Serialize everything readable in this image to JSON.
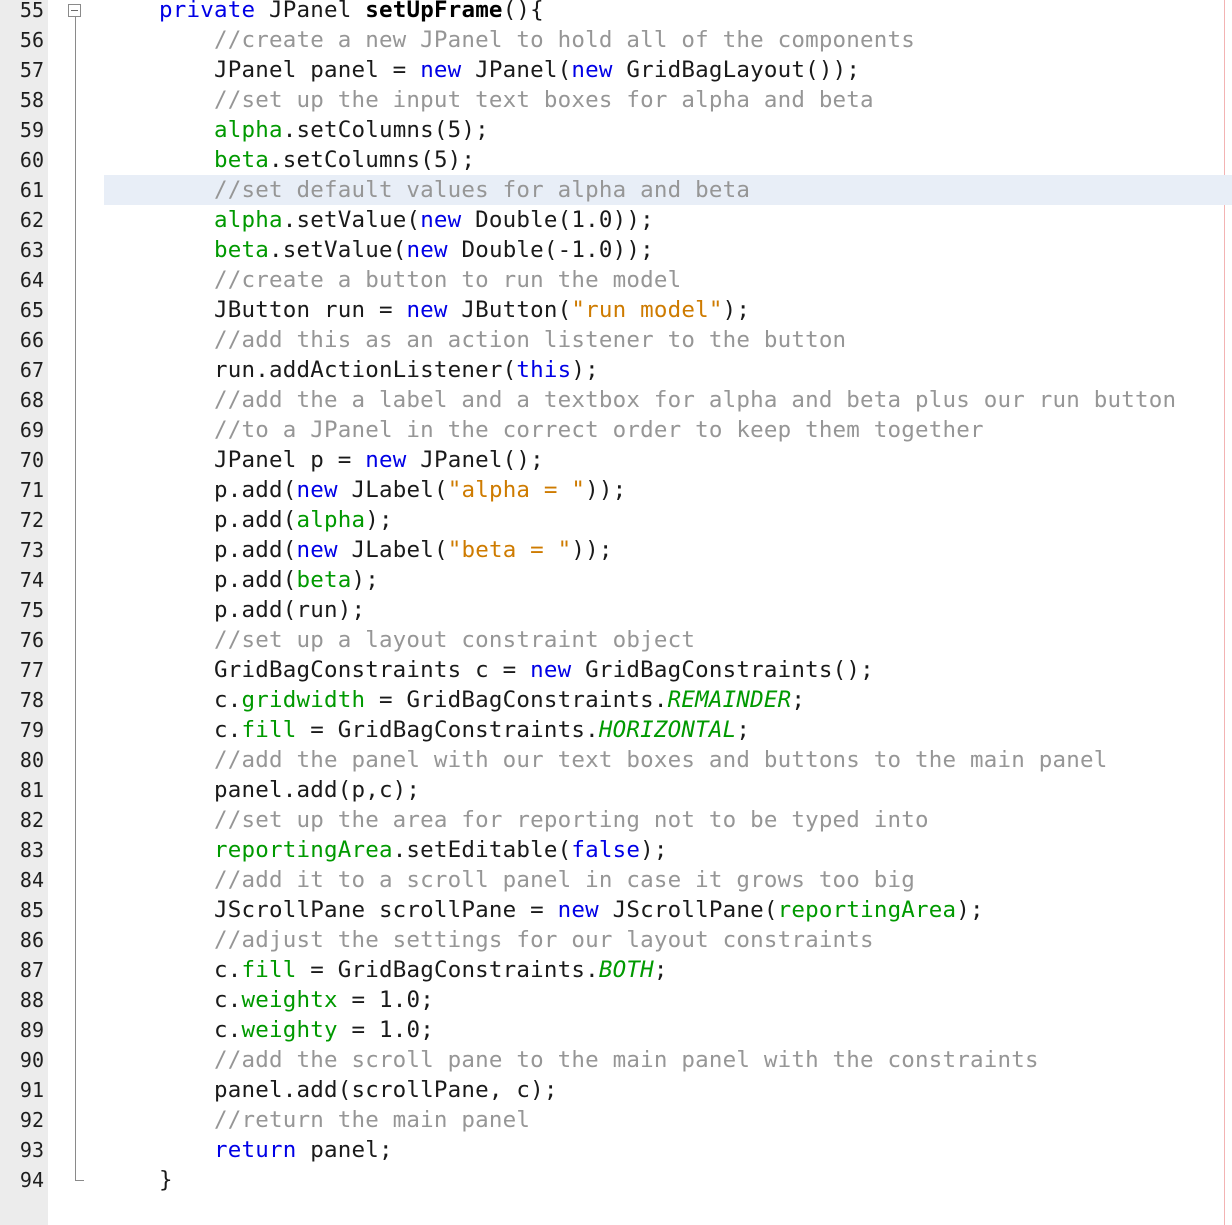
{
  "editor": {
    "indent_unit": "    ",
    "current_line": 61,
    "lines": [
      {
        "n": "55",
        "indent": 1,
        "tokens": [
          [
            "keyword",
            "private"
          ],
          [
            "default",
            " JPanel "
          ],
          [
            "method-bold",
            "setUpFrame"
          ],
          [
            "default",
            "(){"
          ]
        ]
      },
      {
        "n": "56",
        "indent": 2,
        "tokens": [
          [
            "comment",
            "//create a new JPanel to hold all of the components"
          ]
        ]
      },
      {
        "n": "57",
        "indent": 2,
        "tokens": [
          [
            "default",
            "JPanel panel = "
          ],
          [
            "keyword",
            "new"
          ],
          [
            "default",
            " JPanel("
          ],
          [
            "keyword",
            "new"
          ],
          [
            "default",
            " GridBagLayout());"
          ]
        ]
      },
      {
        "n": "58",
        "indent": 2,
        "tokens": [
          [
            "comment",
            "//set up the input text boxes for alpha and beta"
          ]
        ]
      },
      {
        "n": "59",
        "indent": 2,
        "tokens": [
          [
            "field",
            "alpha"
          ],
          [
            "default",
            ".setColumns(5);"
          ]
        ]
      },
      {
        "n": "60",
        "indent": 2,
        "tokens": [
          [
            "field",
            "beta"
          ],
          [
            "default",
            ".setColumns(5);"
          ]
        ]
      },
      {
        "n": "61",
        "indent": 2,
        "tokens": [
          [
            "comment",
            "//set default values for alpha and beta"
          ]
        ]
      },
      {
        "n": "62",
        "indent": 2,
        "tokens": [
          [
            "field",
            "alpha"
          ],
          [
            "default",
            ".setValue("
          ],
          [
            "keyword",
            "new"
          ],
          [
            "default",
            " Double(1.0));"
          ]
        ]
      },
      {
        "n": "63",
        "indent": 2,
        "tokens": [
          [
            "field",
            "beta"
          ],
          [
            "default",
            ".setValue("
          ],
          [
            "keyword",
            "new"
          ],
          [
            "default",
            " Double(-1.0));"
          ]
        ]
      },
      {
        "n": "64",
        "indent": 2,
        "tokens": [
          [
            "comment",
            "//create a button to run the model"
          ]
        ]
      },
      {
        "n": "65",
        "indent": 2,
        "tokens": [
          [
            "default",
            "JButton run = "
          ],
          [
            "keyword",
            "new"
          ],
          [
            "default",
            " JButton("
          ],
          [
            "string",
            "\"run model\""
          ],
          [
            "default",
            ");"
          ]
        ]
      },
      {
        "n": "66",
        "indent": 2,
        "tokens": [
          [
            "comment",
            "//add this as an action listener to the button"
          ]
        ]
      },
      {
        "n": "67",
        "indent": 2,
        "tokens": [
          [
            "default",
            "run.addActionListener("
          ],
          [
            "keyword",
            "this"
          ],
          [
            "default",
            ");"
          ]
        ]
      },
      {
        "n": "68",
        "indent": 2,
        "tokens": [
          [
            "comment",
            "//add the a label and a textbox for alpha and beta plus our run button"
          ]
        ]
      },
      {
        "n": "69",
        "indent": 2,
        "tokens": [
          [
            "comment",
            "//to a JPanel in the correct order to keep them together"
          ]
        ]
      },
      {
        "n": "70",
        "indent": 2,
        "tokens": [
          [
            "default",
            "JPanel p = "
          ],
          [
            "keyword",
            "new"
          ],
          [
            "default",
            " JPanel();"
          ]
        ]
      },
      {
        "n": "71",
        "indent": 2,
        "tokens": [
          [
            "default",
            "p.add("
          ],
          [
            "keyword",
            "new"
          ],
          [
            "default",
            " JLabel("
          ],
          [
            "string",
            "\"alpha = \""
          ],
          [
            "default",
            "));"
          ]
        ]
      },
      {
        "n": "72",
        "indent": 2,
        "tokens": [
          [
            "default",
            "p.add("
          ],
          [
            "field",
            "alpha"
          ],
          [
            "default",
            ");"
          ]
        ]
      },
      {
        "n": "73",
        "indent": 2,
        "tokens": [
          [
            "default",
            "p.add("
          ],
          [
            "keyword",
            "new"
          ],
          [
            "default",
            " JLabel("
          ],
          [
            "string",
            "\"beta = \""
          ],
          [
            "default",
            "));"
          ]
        ]
      },
      {
        "n": "74",
        "indent": 2,
        "tokens": [
          [
            "default",
            "p.add("
          ],
          [
            "field",
            "beta"
          ],
          [
            "default",
            ");"
          ]
        ]
      },
      {
        "n": "75",
        "indent": 2,
        "tokens": [
          [
            "default",
            "p.add(run);"
          ]
        ]
      },
      {
        "n": "76",
        "indent": 2,
        "tokens": [
          [
            "comment",
            "//set up a layout constraint object"
          ]
        ]
      },
      {
        "n": "77",
        "indent": 2,
        "tokens": [
          [
            "default",
            "GridBagConstraints c = "
          ],
          [
            "keyword",
            "new"
          ],
          [
            "default",
            " GridBagConstraints();"
          ]
        ]
      },
      {
        "n": "78",
        "indent": 2,
        "tokens": [
          [
            "default",
            "c."
          ],
          [
            "field",
            "gridwidth"
          ],
          [
            "default",
            " = GridBagConstraints."
          ],
          [
            "static-italic",
            "REMAINDER"
          ],
          [
            "default",
            ";"
          ]
        ]
      },
      {
        "n": "79",
        "indent": 2,
        "tokens": [
          [
            "default",
            "c."
          ],
          [
            "field",
            "fill"
          ],
          [
            "default",
            " = GridBagConstraints."
          ],
          [
            "static-italic",
            "HORIZONTAL"
          ],
          [
            "default",
            ";"
          ]
        ]
      },
      {
        "n": "80",
        "indent": 2,
        "tokens": [
          [
            "comment",
            "//add the panel with our text boxes and buttons to the main panel"
          ]
        ]
      },
      {
        "n": "81",
        "indent": 2,
        "tokens": [
          [
            "default",
            "panel.add(p,c);"
          ]
        ]
      },
      {
        "n": "82",
        "indent": 2,
        "tokens": [
          [
            "comment",
            "//set up the area for reporting not to be typed into"
          ]
        ]
      },
      {
        "n": "83",
        "indent": 2,
        "tokens": [
          [
            "field",
            "reportingArea"
          ],
          [
            "default",
            ".setEditable("
          ],
          [
            "keyword",
            "false"
          ],
          [
            "default",
            ");"
          ]
        ]
      },
      {
        "n": "84",
        "indent": 2,
        "tokens": [
          [
            "comment",
            "//add it to a scroll panel in case it grows too big"
          ]
        ]
      },
      {
        "n": "85",
        "indent": 2,
        "tokens": [
          [
            "default",
            "JScrollPane scrollPane = "
          ],
          [
            "keyword",
            "new"
          ],
          [
            "default",
            " JScrollPane("
          ],
          [
            "field",
            "reportingArea"
          ],
          [
            "default",
            ");"
          ]
        ]
      },
      {
        "n": "86",
        "indent": 2,
        "tokens": [
          [
            "comment",
            "//adjust the settings for our layout constraints"
          ]
        ]
      },
      {
        "n": "87",
        "indent": 2,
        "tokens": [
          [
            "default",
            "c."
          ],
          [
            "field",
            "fill"
          ],
          [
            "default",
            " = GridBagConstraints."
          ],
          [
            "static-italic",
            "BOTH"
          ],
          [
            "default",
            ";"
          ]
        ]
      },
      {
        "n": "88",
        "indent": 2,
        "tokens": [
          [
            "default",
            "c."
          ],
          [
            "field",
            "weightx"
          ],
          [
            "default",
            " = 1.0;"
          ]
        ]
      },
      {
        "n": "89",
        "indent": 2,
        "tokens": [
          [
            "default",
            "c."
          ],
          [
            "field",
            "weighty"
          ],
          [
            "default",
            " = 1.0;"
          ]
        ]
      },
      {
        "n": "90",
        "indent": 2,
        "tokens": [
          [
            "comment",
            "//add the scroll pane to the main panel with the constraints"
          ]
        ]
      },
      {
        "n": "91",
        "indent": 2,
        "tokens": [
          [
            "default",
            "panel.add(scrollPane, c);"
          ]
        ]
      },
      {
        "n": "92",
        "indent": 2,
        "tokens": [
          [
            "comment",
            "//return the main panel"
          ]
        ]
      },
      {
        "n": "93",
        "indent": 2,
        "tokens": [
          [
            "keyword",
            "return"
          ],
          [
            "default",
            " panel;"
          ]
        ]
      },
      {
        "n": "94",
        "indent": 1,
        "tokens": [
          [
            "default",
            "}"
          ]
        ]
      }
    ]
  }
}
